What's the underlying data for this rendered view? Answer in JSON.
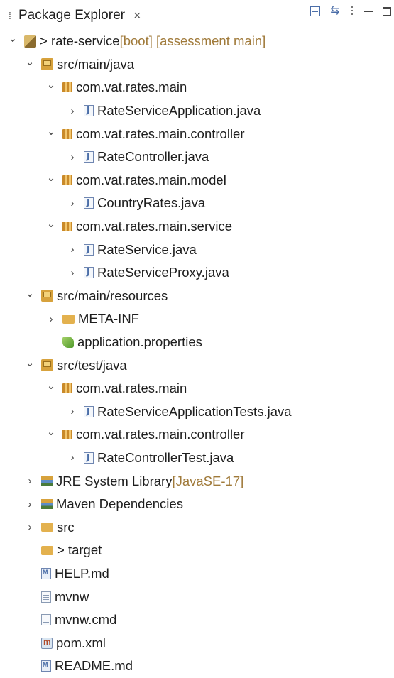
{
  "view": {
    "title": "Package Explorer",
    "close_glyph": "×",
    "toolbar": [
      "collapse-all-icon",
      "link-with-editor-icon",
      "view-menu-icon",
      "minimize-icon",
      "maximize-icon"
    ]
  },
  "tree": [
    {
      "label": "> rate-service",
      "decoration": " [boot] [assessment main]",
      "icon": "project-icon",
      "level": 0,
      "expanded": true,
      "has_children": true
    },
    {
      "label": "src/main/java",
      "icon": "source-folder-icon",
      "level": 1,
      "expanded": true,
      "has_children": true
    },
    {
      "label": "com.vat.rates.main",
      "icon": "package-icon",
      "level": 2,
      "expanded": true,
      "has_children": true
    },
    {
      "label": "RateServiceApplication.java",
      "icon": "java-file-icon",
      "level": 3,
      "expanded": false,
      "has_children": true
    },
    {
      "label": "com.vat.rates.main.controller",
      "icon": "package-icon",
      "level": 2,
      "expanded": true,
      "has_children": true
    },
    {
      "label": "RateController.java",
      "icon": "java-file-icon",
      "level": 3,
      "expanded": false,
      "has_children": true
    },
    {
      "label": "com.vat.rates.main.model",
      "icon": "package-icon",
      "level": 2,
      "expanded": true,
      "has_children": true
    },
    {
      "label": "CountryRates.java",
      "icon": "java-file-icon",
      "level": 3,
      "expanded": false,
      "has_children": true
    },
    {
      "label": "com.vat.rates.main.service",
      "icon": "package-icon",
      "level": 2,
      "expanded": true,
      "has_children": true
    },
    {
      "label": "RateService.java",
      "icon": "java-file-icon",
      "level": 3,
      "expanded": false,
      "has_children": true
    },
    {
      "label": "RateServiceProxy.java",
      "icon": "java-file-icon",
      "level": 3,
      "expanded": false,
      "has_children": true
    },
    {
      "label": "src/main/resources",
      "icon": "source-folder-icon",
      "level": 1,
      "expanded": true,
      "has_children": true
    },
    {
      "label": "META-INF",
      "icon": "folder-icon",
      "level": 2,
      "expanded": false,
      "has_children": true
    },
    {
      "label": "application.properties",
      "icon": "properties-file-icon",
      "level": 2,
      "expanded": false,
      "has_children": false
    },
    {
      "label": "src/test/java",
      "icon": "source-folder-icon",
      "level": 1,
      "expanded": true,
      "has_children": true
    },
    {
      "label": "com.vat.rates.main",
      "icon": "package-icon",
      "level": 2,
      "expanded": true,
      "has_children": true
    },
    {
      "label": "RateServiceApplicationTests.java",
      "icon": "java-file-icon",
      "level": 3,
      "expanded": false,
      "has_children": true
    },
    {
      "label": "com.vat.rates.main.controller",
      "icon": "package-icon",
      "level": 2,
      "expanded": true,
      "has_children": true
    },
    {
      "label": "RateControllerTest.java",
      "icon": "java-file-icon",
      "level": 3,
      "expanded": false,
      "has_children": true
    },
    {
      "label": "JRE System Library",
      "decoration": " [JavaSE-17]",
      "icon": "library-icon",
      "level": 1,
      "expanded": false,
      "has_children": true
    },
    {
      "label": "Maven Dependencies",
      "icon": "library-icon",
      "level": 1,
      "expanded": false,
      "has_children": true
    },
    {
      "label": "src",
      "icon": "folder-icon",
      "level": 1,
      "expanded": false,
      "has_children": true
    },
    {
      "label": "> target",
      "icon": "folder-icon",
      "level": 1,
      "expanded": false,
      "has_children": false
    },
    {
      "label": "HELP.md",
      "icon": "markdown-file-icon",
      "level": 1,
      "expanded": false,
      "has_children": false
    },
    {
      "label": "mvnw",
      "icon": "text-file-icon",
      "level": 1,
      "expanded": false,
      "has_children": false
    },
    {
      "label": "mvnw.cmd",
      "icon": "text-file-icon",
      "level": 1,
      "expanded": false,
      "has_children": false
    },
    {
      "label": "pom.xml",
      "icon": "maven-pom-icon",
      "level": 1,
      "expanded": false,
      "has_children": false
    },
    {
      "label": "README.md",
      "icon": "markdown-file-icon",
      "level": 1,
      "expanded": false,
      "has_children": false
    }
  ]
}
